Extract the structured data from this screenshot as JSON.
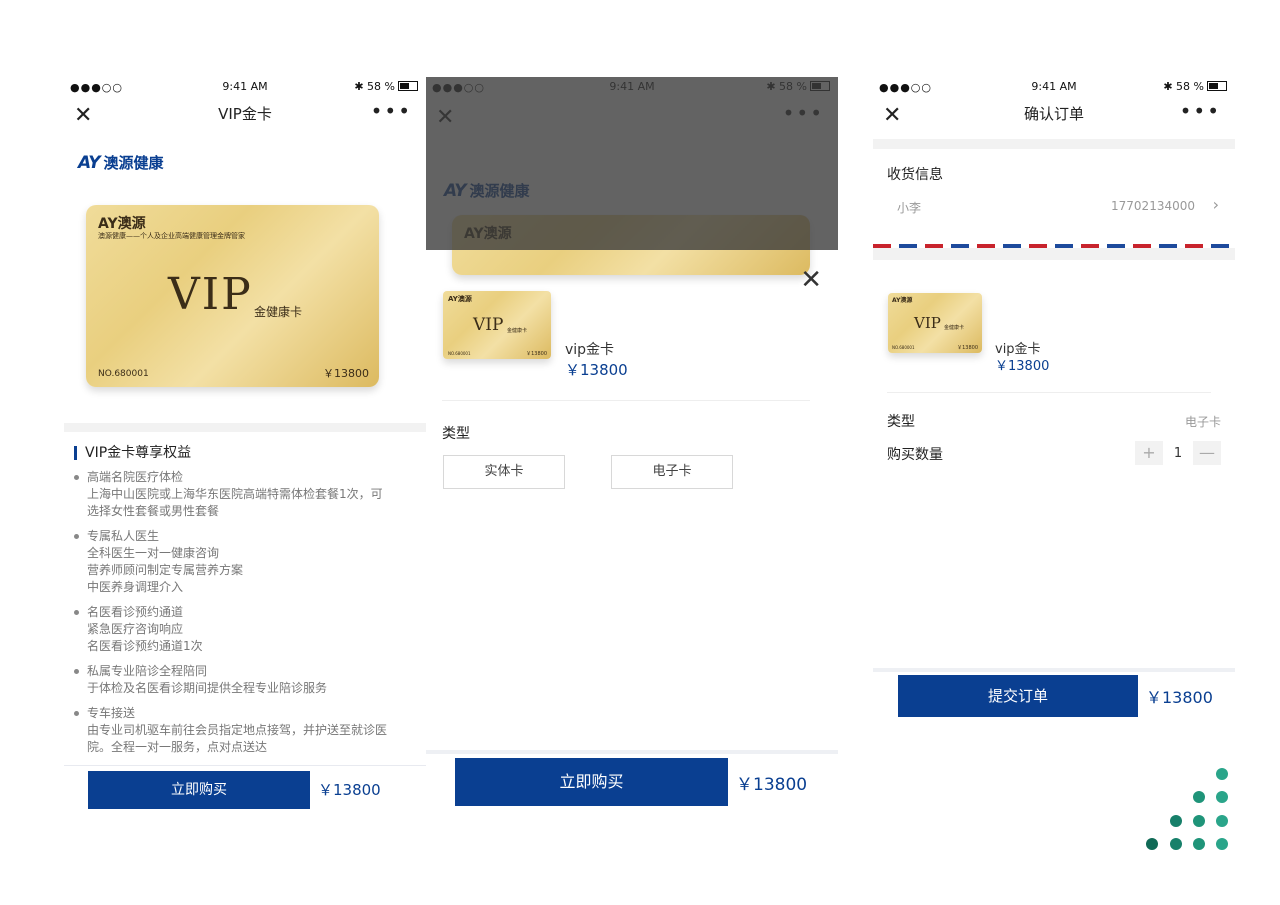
{
  "status": {
    "signal": "●●●○○",
    "time": "9:41 AM",
    "battery": "58 %"
  },
  "screen1": {
    "title": "VIP金卡",
    "close_icon": "✕",
    "more_icon": "•••",
    "logo_mark": "AY",
    "logo_text": "澳源健康",
    "card": {
      "brand": "AY澳源",
      "slogan": "澳源健康——个人及企业高端健康管理金牌管家",
      "vip": "VIP",
      "sub": "金健康卡",
      "no": "NO.680001",
      "price": "￥13800"
    },
    "benefits_title": "VIP金卡尊享权益",
    "benefits": [
      {
        "title": "高端名院医疗体检",
        "desc": "上海中山医院或上海华东医院高端特需体检套餐1次，可选择女性套餐或男性套餐"
      },
      {
        "title": "专属私人医生",
        "desc": "全科医生一对一健康咨询\n营养师顾问制定专属营养方案\n中医养身调理介入"
      },
      {
        "title": "名医看诊预约通道",
        "desc": "紧急医疗咨询响应\n名医看诊预约通道1次"
      },
      {
        "title": "私属专业陪诊全程陪同",
        "desc": "于体检及名医看诊期间提供全程专业陪诊服务"
      },
      {
        "title": "专车接送",
        "desc": "由专业司机驱车前往会员指定地点接驾，并护送至就诊医院。全程一对一服务，点对点送达"
      }
    ],
    "buy_label": "立即购买",
    "price": "￥13800"
  },
  "screen2": {
    "product_name": "vip金卡",
    "product_price": "￥13800",
    "type_label": "类型",
    "options": [
      "实体卡",
      "电子卡"
    ],
    "buy_label": "立即购买",
    "price": "￥13800",
    "card": {
      "brand": "AY澳源",
      "vip": "VIP",
      "sub": "金健康卡",
      "price": "￥13800",
      "no": "NO.680001"
    }
  },
  "screen3": {
    "title": "确认订单",
    "shipping_title": "收货信息",
    "recipient_name": "小李",
    "recipient_phone": "17702134000",
    "product_name": "vip金卡",
    "product_price": "￥13800",
    "type_label": "类型",
    "type_value": "电子卡",
    "qty_label": "购买数量",
    "qty_value": "1",
    "plus": "+",
    "minus": "—",
    "submit_label": "提交订单",
    "price": "￥13800",
    "card": {
      "brand": "AY澳源",
      "vip": "VIP",
      "sub": "金健康卡",
      "price": "￥13800",
      "no": "NO.680001"
    }
  },
  "colors": {
    "brand_blue": "#0a3f91",
    "gold": "#e9cf7f",
    "decor_green": "#1a8a73"
  }
}
